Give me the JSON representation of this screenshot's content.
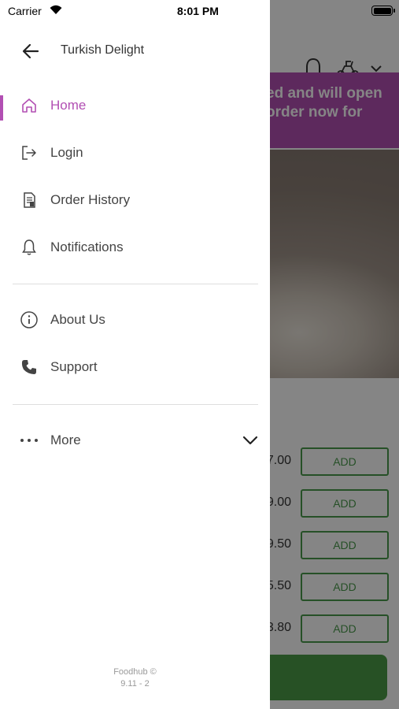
{
  "status_bar": {
    "carrier": "Carrier",
    "time": "8:01 PM"
  },
  "drawer": {
    "title": "Turkish Delight",
    "items": [
      {
        "label": "Home",
        "icon": "home-icon",
        "active": true
      },
      {
        "label": "Login",
        "icon": "login-icon",
        "active": false
      },
      {
        "label": "Order History",
        "icon": "receipt-icon",
        "active": false
      },
      {
        "label": "Notifications",
        "icon": "bell-icon",
        "active": false
      },
      {
        "label": "About Us",
        "icon": "info-icon",
        "active": false
      },
      {
        "label": "Support",
        "icon": "phone-icon",
        "active": false
      },
      {
        "label": "More",
        "icon": "ellipsis-icon",
        "active": false
      }
    ],
    "footer": {
      "brand": "Foodhub ©",
      "version": "9.11 - 2"
    }
  },
  "background": {
    "banner_line1": "ed and will open",
    "banner_line2": "order now for",
    "prices": [
      ".7.00",
      "9.00",
      "9.50",
      "5.50",
      "3.80"
    ],
    "add_label": "ADD"
  },
  "colors": {
    "accent": "#b24fb3",
    "add_green": "#4a9a4c",
    "cta_green": "#4b9c48"
  }
}
